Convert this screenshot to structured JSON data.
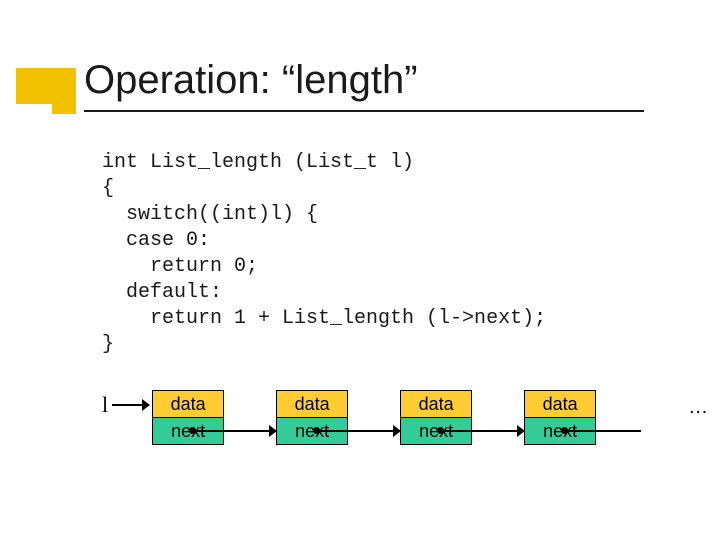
{
  "title": "Operation: “length”",
  "code": {
    "l1": "int List_length (List_t l)",
    "l2": "{",
    "l3": "  switch((int)l) {",
    "l4": "  case 0:",
    "l5": "    return 0;",
    "l6": "  default:",
    "l7": "    return 1 + List_length (l->next);",
    "l8": "}"
  },
  "list": {
    "var": "l",
    "data_label": "data",
    "next_label": "next",
    "ellipsis": "…"
  }
}
